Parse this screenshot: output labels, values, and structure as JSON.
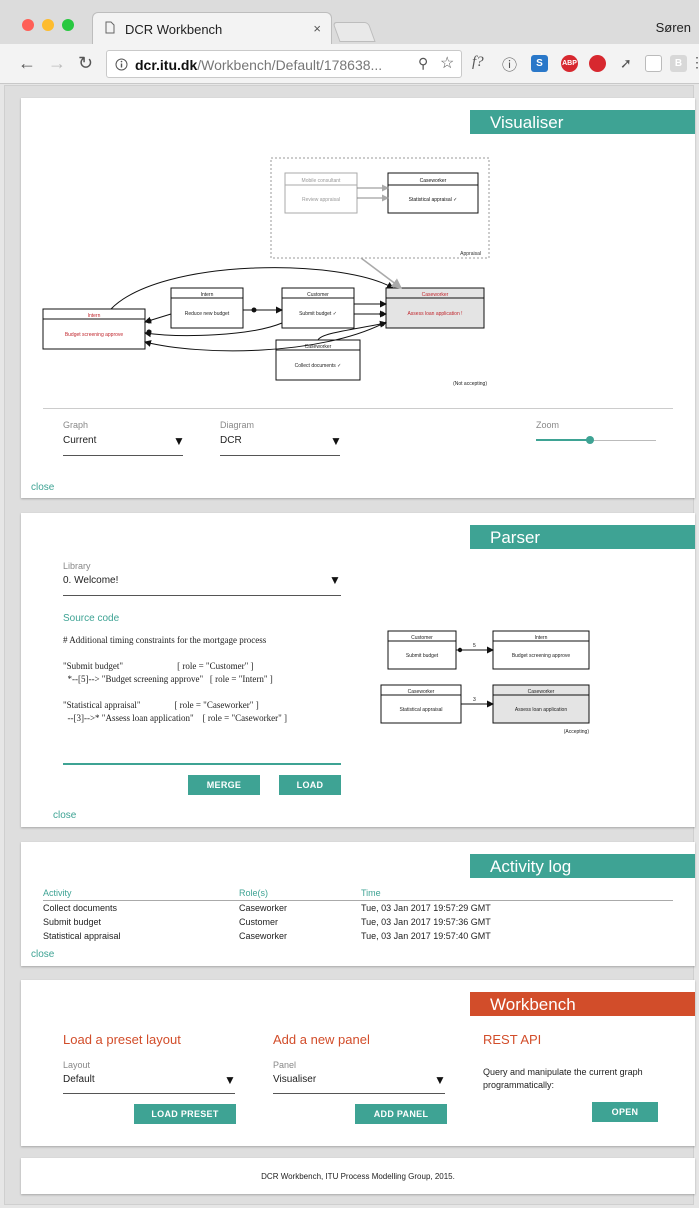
{
  "browser": {
    "tab_title": "DCR Workbench",
    "tab_close": "×",
    "profile_name": "Søren",
    "url_host": "dcr.itu.dk",
    "url_path": "/Workbench/Default/178638...",
    "toolbar_f": "f?"
  },
  "visualiser": {
    "title": "Visualiser",
    "graph_label": "Graph",
    "graph_value": "Current",
    "diagram_label": "Diagram",
    "diagram_value": "DCR",
    "zoom_label": "Zoom",
    "zoom_level": 0.45,
    "close": "close",
    "diagram": {
      "nested_roles": [
        "Mobile consultant",
        "Caseworker"
      ],
      "nested_events": [
        "Review appraisal",
        "Statistical appraisal ✓"
      ],
      "nested_group_label": "Appraisal",
      "events": [
        {
          "role": "Intern",
          "name": "Budget screening approve",
          "color": "#c0262d"
        },
        {
          "role": "Intern",
          "name": "Reduce new budget",
          "color": "#222"
        },
        {
          "role": "Customer",
          "name": "Submit budget ✓",
          "color": "#222"
        },
        {
          "role": "Caseworker",
          "name": "Assess loan application !",
          "color": "#c0262d"
        },
        {
          "role": "Caseworker",
          "name": "Collect documents ✓",
          "color": "#222"
        }
      ],
      "status": "(Not accepting)"
    }
  },
  "parser": {
    "title": "Parser",
    "library_label": "Library",
    "library_value": "0. Welcome!",
    "source_code_label": "Source code",
    "code_lines": [
      "# Additional timing constraints for the mortgage process",
      "",
      "\"Submit budget\"                        [ role = \"Customer\" ]",
      "  *--[5]--> \"Budget screening approve\"   [ role = \"Intern\" ]",
      "",
      "\"Statistical appraisal\"               [ role = \"Caseworker\" ]",
      "  --[3]-->* \"Assess loan application\"    [ role = \"Caseworker\" ]"
    ],
    "merge": "MERGE",
    "load": "LOAD",
    "close": "close",
    "preview": {
      "events": [
        {
          "role": "Customer",
          "name": "Submit budget"
        },
        {
          "role": "Intern",
          "name": "Budget screening approve"
        },
        {
          "role": "Caseworker",
          "name": "Statistical appraisal"
        },
        {
          "role": "Caseworker",
          "name": "Assess loan application"
        }
      ],
      "delay_top": "5",
      "delay_bottom": "3",
      "status": "(Accepting)"
    }
  },
  "activity_log": {
    "title": "Activity log",
    "headers": [
      "Activity",
      "Role(s)",
      "Time"
    ],
    "rows": [
      [
        "Collect documents",
        "Caseworker",
        "Tue, 03 Jan 2017 19:57:29 GMT"
      ],
      [
        "Submit budget",
        "Customer",
        "Tue, 03 Jan 2017 19:57:36 GMT"
      ],
      [
        "Statistical appraisal",
        "Caseworker",
        "Tue, 03 Jan 2017 19:57:40 GMT"
      ]
    ],
    "close": "close"
  },
  "workbench": {
    "title": "Workbench",
    "preset_heading": "Load a preset layout",
    "layout_label": "Layout",
    "layout_value": "Default",
    "load_preset": "LOAD PRESET",
    "panel_heading": "Add a new panel",
    "panel_label": "Panel",
    "panel_value": "Visualiser",
    "add_panel": "ADD PANEL",
    "rest_heading": "REST API",
    "rest_text": "Query and manipulate the current graph programmatically:",
    "open": "OPEN"
  },
  "footer": {
    "text": "DCR Workbench, ITU Process Modelling Group, 2015."
  },
  "colors": {
    "accent": "#3ea394",
    "workbench": "#d24d2a",
    "pending": "#c0262d"
  }
}
